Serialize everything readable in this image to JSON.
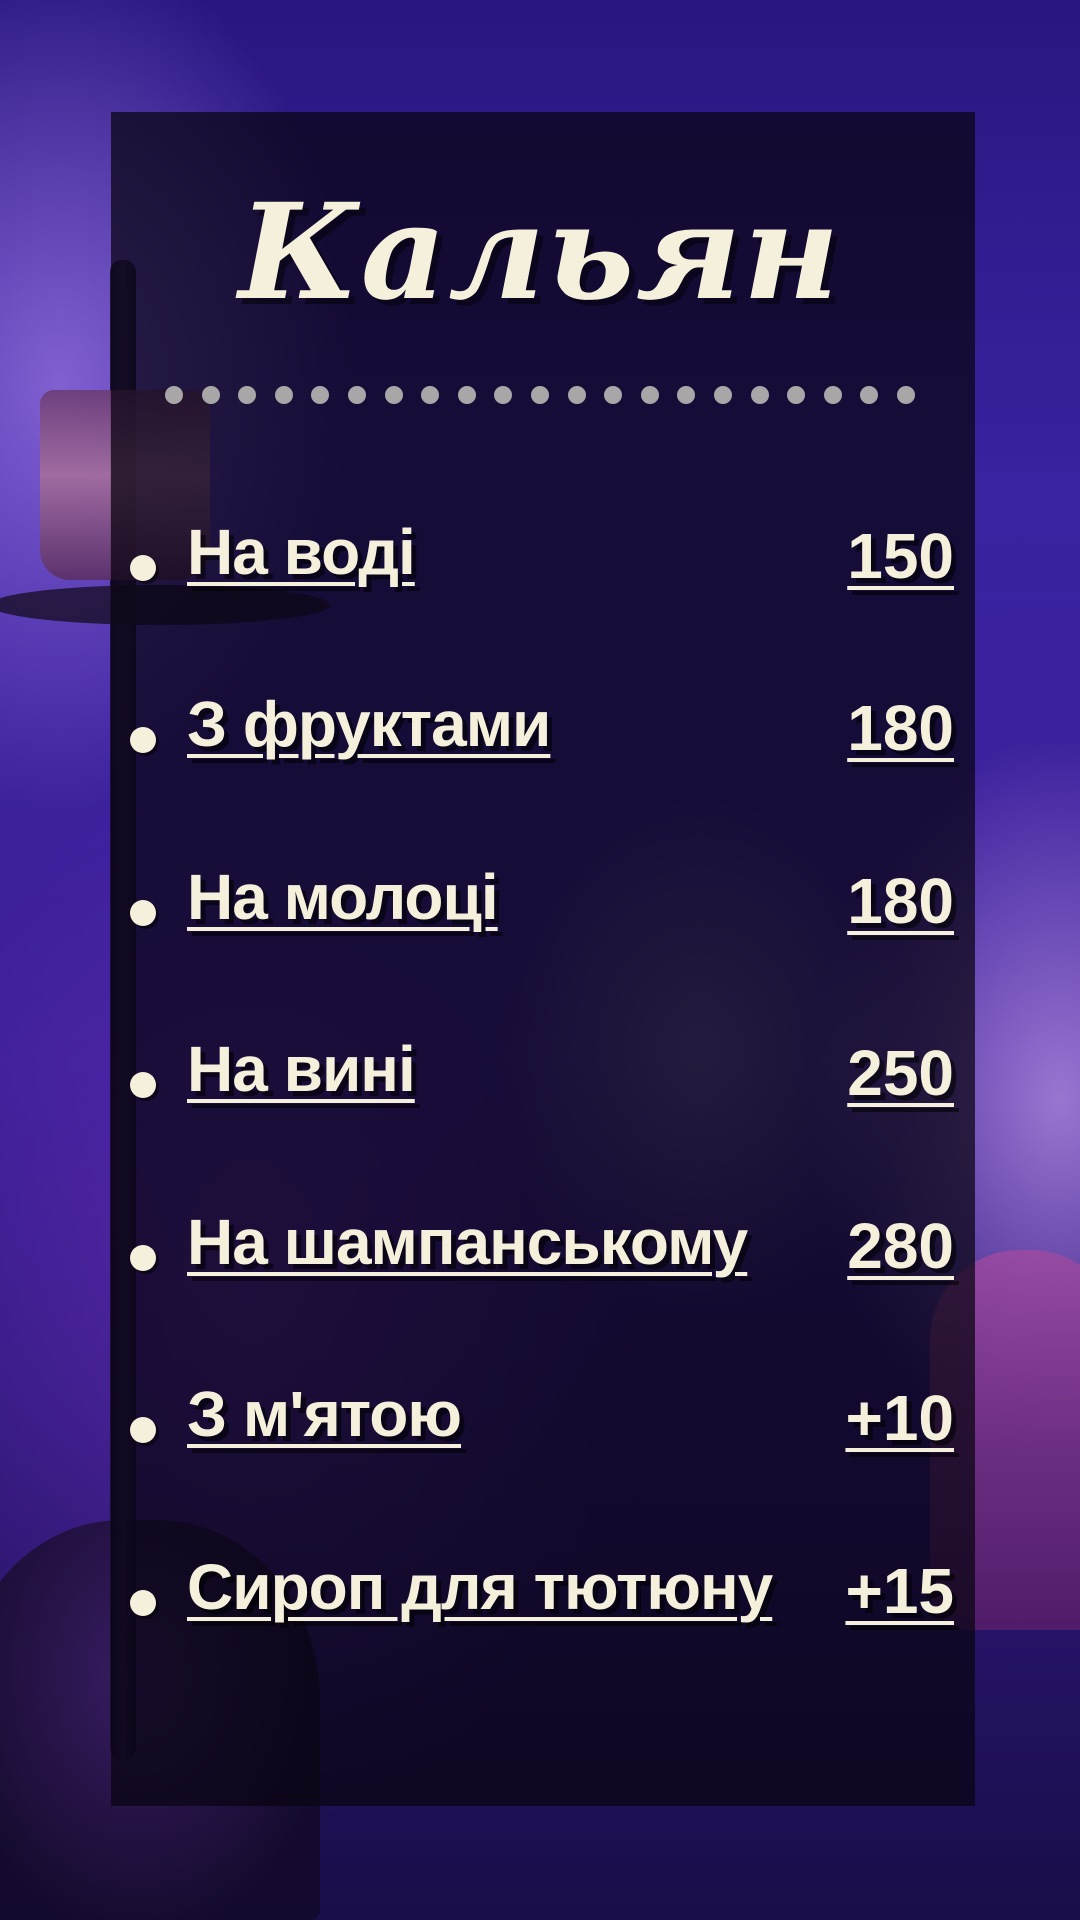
{
  "menu": {
    "title": "Кальян",
    "items": [
      {
        "name": "На воді",
        "price": "150"
      },
      {
        "name": "З фруктами",
        "price": "180"
      },
      {
        "name": "На молоці",
        "price": "180"
      },
      {
        "name": "На вині",
        "price": "250"
      },
      {
        "name": "На шампанському",
        "price": "280"
      },
      {
        "name": "З м'ятою",
        "price": "+10"
      },
      {
        "name": "Сироп для тютюну",
        "price": "+15"
      }
    ]
  },
  "colors": {
    "text": "#f4f0dc",
    "panel": "#080410",
    "dots": "#a9a6a8",
    "background": "#3a22a0"
  }
}
